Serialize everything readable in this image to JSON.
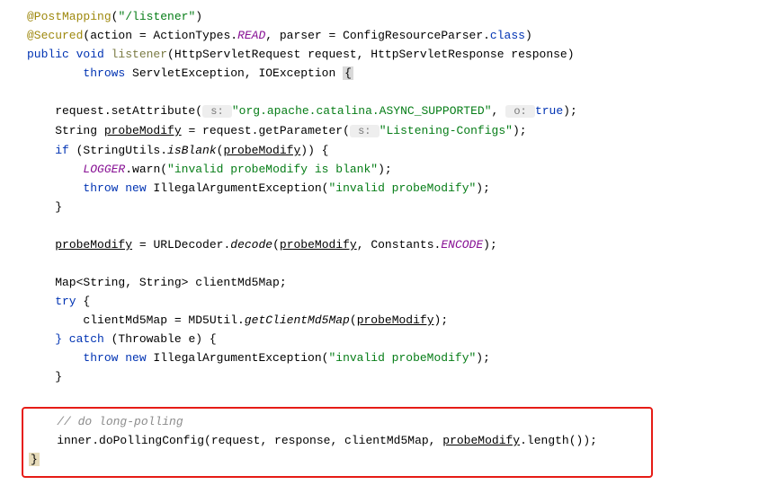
{
  "lines": {
    "l1_anno1": "@PostMapping",
    "l1_paren1": "(",
    "l1_str": "\"/listener\"",
    "l1_paren2": ")",
    "l2_anno": "@Secured",
    "l2_paren1": "(action = ActionTypes.",
    "l2_read": "READ",
    "l2_parser": ", parser = ConfigResourceParser.",
    "l2_class": "class",
    "l2_paren2": ")",
    "l3_public": "public",
    "l3_void": " void",
    "l3_method": " listener",
    "l3_sig": "(HttpServletRequest request, HttpServletResponse response)",
    "l4_throws": "        throws",
    "l4_ex": " ServletException, IOException ",
    "l4_brace": "{",
    "l6_indent": "    request.setAttribute(",
    "l6_hint1": " s: ",
    "l6_str1": "\"org.apache.catalina.ASYNC_SUPPORTED\"",
    "l6_comma": ", ",
    "l6_hint2": " o: ",
    "l6_true": "true",
    "l6_end": ");",
    "l7_a": "    String ",
    "l7_var": "probeModify",
    "l7_b": " = request.getParameter(",
    "l7_hint": " s: ",
    "l7_str": "\"Listening-Configs\"",
    "l7_end": ");",
    "l8_if": "    if",
    "l8_a": " (StringUtils.",
    "l8_isblank": "isBlank",
    "l8_b": "(",
    "l8_var": "probeModify",
    "l8_c": ")) {",
    "l9_a": "        ",
    "l9_logger": "LOGGER",
    "l9_b": ".warn(",
    "l9_str": "\"invalid probeModify is blank\"",
    "l9_c": ");",
    "l10_throw": "        throw new",
    "l10_a": " IllegalArgumentException(",
    "l10_str": "\"invalid probeModify\"",
    "l10_b": ");",
    "l11": "    }",
    "l13_a": "    ",
    "l13_var1": "probeModify",
    "l13_b": " = URLDecoder.",
    "l13_decode": "decode",
    "l13_c": "(",
    "l13_var2": "probeModify",
    "l13_d": ", Constants.",
    "l13_encode": "ENCODE",
    "l13_e": ");",
    "l15": "    Map<String, String> clientMd5Map;",
    "l16_try": "    try",
    "l16_b": " {",
    "l17_a": "        clientMd5Map = MD5Util.",
    "l17_method": "getClientMd5Map",
    "l17_b": "(",
    "l17_var": "probeModify",
    "l17_c": ");",
    "l18_catch": "    } catch",
    "l18_b": " (Throwable e) {",
    "l19_throw": "        throw new",
    "l19_a": " IllegalArgumentException(",
    "l19_str": "\"invalid probeModify\"",
    "l19_b": ");",
    "l20": "    }",
    "l22_comment": "    // do long-polling",
    "l23_a": "    inner.doPollingConfig(request, response, clientMd5Map, ",
    "l23_var": "probeModify",
    "l23_b": ".length());",
    "l24": "}"
  }
}
